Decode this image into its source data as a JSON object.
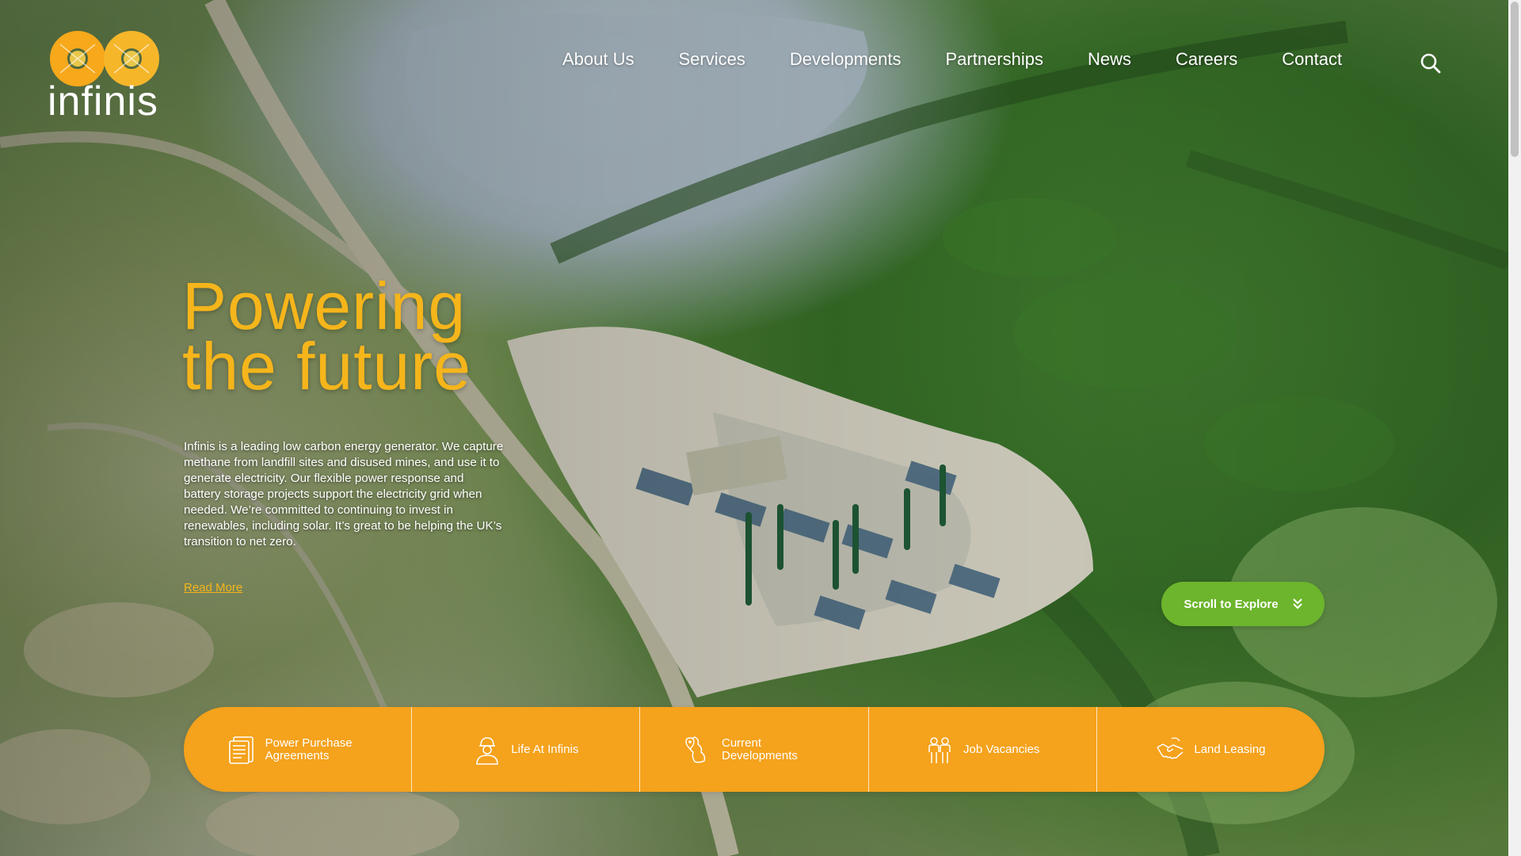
{
  "brand": {
    "name": "infinis",
    "accent": "#f5a21c",
    "headline_color": "#f5b51b",
    "cta_color": "#6cb52c"
  },
  "nav": {
    "items": [
      {
        "label": "About Us"
      },
      {
        "label": "Services"
      },
      {
        "label": "Developments"
      },
      {
        "label": "Partnerships"
      },
      {
        "label": "News"
      },
      {
        "label": "Careers"
      },
      {
        "label": "Contact"
      }
    ],
    "search_icon": "search-icon"
  },
  "hero": {
    "title_line1": "Powering",
    "title_line2": "the future",
    "body": "Infinis is a leading low carbon energy generator. We capture methane from landfill sites and disused mines, and use it to generate electricity. Our flexible power response and battery storage projects support the electricity grid when needed. We’re committed to continuing to invest in renewables, including solar. It’s great to be helping the UK’s transition to net zero.",
    "read_more": "Read More"
  },
  "scroll_cta": {
    "label": "Scroll to Explore",
    "icon": "double-chevron-down-icon"
  },
  "quick_links": [
    {
      "label": "Power Purchase Agreements",
      "icon": "document-icon"
    },
    {
      "label": "Life At Infinis",
      "icon": "worker-icon"
    },
    {
      "label": "Current Developments",
      "icon": "uk-map-pin-icon"
    },
    {
      "label": "Job Vacancies",
      "icon": "people-icon"
    },
    {
      "label": "Land Leasing",
      "icon": "handshake-icon"
    }
  ]
}
